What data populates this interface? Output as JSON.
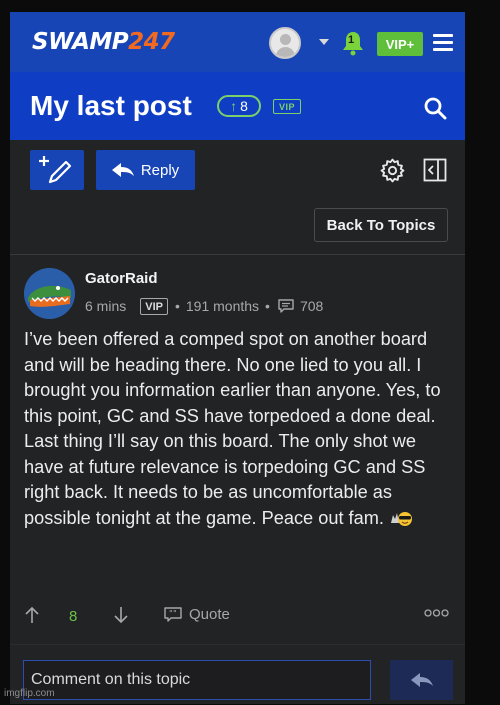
{
  "header": {
    "logo_text": "SWAMP",
    "logo_number": "247",
    "notification_count": "1",
    "vip_label": "VIP+"
  },
  "title_bar": {
    "title": "My last post",
    "score": "8",
    "vip_tag": "VIP"
  },
  "toolbar": {
    "reply_label": "Reply",
    "back_label": "Back To Topics"
  },
  "post": {
    "username": "GatorRaid",
    "time": "6 mins",
    "vip_badge": "VIP",
    "separator": "•",
    "tenure": "191 months",
    "post_count": "708",
    "body": "I’ve been offered a comped spot on another board and will be heading there. No one lied to you all. I brought you information earlier than anyone. Yes, to this point, GC and SS have torpedoed a done deal. Last thing I’ll say on this board. The only shot we have at future relevance is torpedoing GC and SS right back. It needs to be as uncomfortable as possible tonight at the game. Peace out fam.",
    "vote_count": "8",
    "quote_label": "Quote"
  },
  "comment": {
    "placeholder": "Comment on this topic"
  },
  "watermark": "imgflip.com",
  "colors": {
    "brand_blue": "#1745b5",
    "accent_green": "#5fbf3a",
    "logo_orange": "#f26a21",
    "background": "#222325"
  },
  "icons": [
    "user-avatar-icon",
    "chevron-down-icon",
    "bell-icon",
    "hamburger-icon",
    "search-icon",
    "compose-icon",
    "reply-arrow-icon",
    "gear-icon",
    "panel-toggle-icon",
    "message-icon",
    "arrow-up-icon",
    "arrow-down-icon",
    "quote-icon",
    "more-icon",
    "send-icon"
  ]
}
